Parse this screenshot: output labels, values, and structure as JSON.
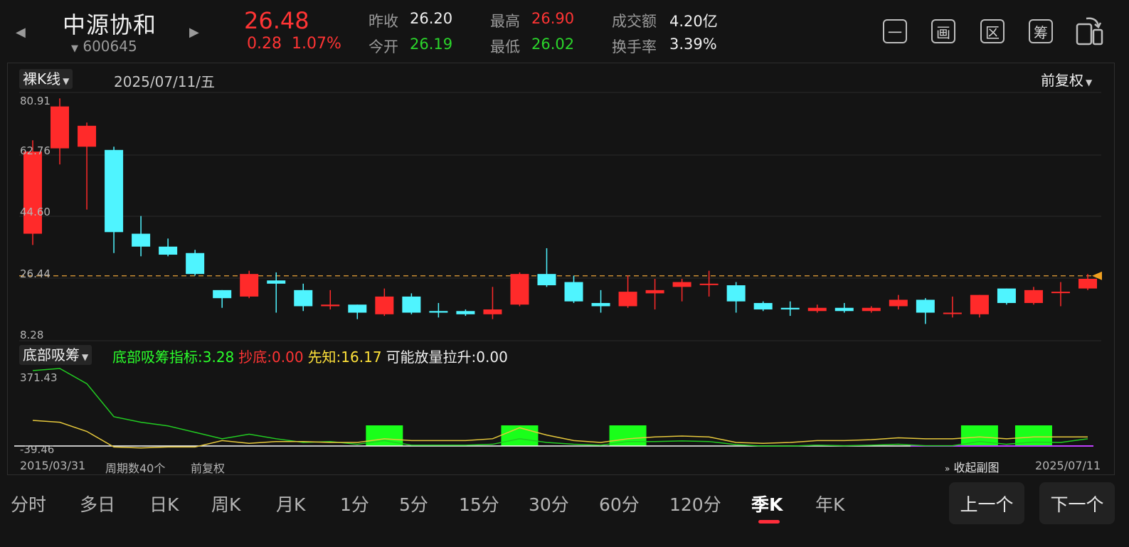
{
  "header": {
    "stock_name": "中源协和",
    "stock_code": "600645",
    "price": "26.48",
    "change_abs": "0.28",
    "change_pct": "1.07%",
    "prev_close_label": "昨收",
    "prev_close": "26.20",
    "open_label": "今开",
    "open": "26.19",
    "high_label": "最高",
    "high": "26.90",
    "low_label": "最低",
    "low": "26.02",
    "turnover_label": "成交额",
    "turnover": "4.20亿",
    "turnover_rate_label": "换手率",
    "turnover_rate": "3.39%",
    "icons": [
      "一",
      "画",
      "区",
      "筹",
      "rotate-screen-icon"
    ]
  },
  "main_chart": {
    "type_selector": "裸K线",
    "date": "2025/07/11/五",
    "adjust_mode": "前复权",
    "y_labels": [
      "80.91",
      "62.76",
      "44.60",
      "26.44",
      "8.28"
    ]
  },
  "indicator": {
    "selector": "底部吸筹",
    "values": [
      {
        "text": "底部吸筹指标:3.28",
        "color": "#2bff2b"
      },
      {
        "text": "抄底:0.00",
        "color": "#ff3434"
      },
      {
        "text": "先知:16.17",
        "color": "#ffe23a"
      },
      {
        "text": "可能放量拉升:0.00",
        "color": "#f0f0f0"
      }
    ],
    "y_top": "371.43",
    "y_bottom": "-39.46"
  },
  "footer": {
    "start_date": "2015/03/31",
    "period_count": "周期数40个",
    "adjust": "前复权",
    "collapse": "收起副图",
    "end_date": "2025/07/11"
  },
  "tabs": [
    "分时",
    "多日",
    "日K",
    "周K",
    "月K",
    "1分",
    "5分",
    "15分",
    "30分",
    "60分",
    "120分",
    "季K",
    "年K"
  ],
  "active_tab": "季K",
  "nav": {
    "prev": "上一个",
    "next": "下一个"
  },
  "colors": {
    "up": "#ff2a2a",
    "down": "#4ff4ff",
    "ref_line": "#e8a23a",
    "green_bar": "#1aff1a",
    "green_line": "#22cc22",
    "yellow_line": "#e6c83c"
  },
  "chart_data": {
    "type": "candlestick",
    "ylim": [
      8.28,
      80.91
    ],
    "last_price_line": 26.44,
    "candles": [
      {
        "o": 39.5,
        "c": 65.0,
        "h": 68.5,
        "l": 36.0
      },
      {
        "o": 66.0,
        "c": 79.0,
        "h": 81.5,
        "l": 61.0
      },
      {
        "o": 66.5,
        "c": 73.0,
        "h": 74.0,
        "l": 47.0
      },
      {
        "o": 65.5,
        "c": 40.0,
        "h": 66.5,
        "l": 33.5
      },
      {
        "o": 39.5,
        "c": 35.5,
        "h": 45.0,
        "l": 32.5
      },
      {
        "o": 35.5,
        "c": 33.0,
        "h": 38.0,
        "l": 32.5
      },
      {
        "o": 33.5,
        "c": 27.0,
        "h": 34.5,
        "l": 26.5
      },
      {
        "o": 22.0,
        "c": 19.5,
        "h": 22.0,
        "l": 16.5
      },
      {
        "o": 20.0,
        "c": 27.0,
        "h": 28.0,
        "l": 19.5
      },
      {
        "o": 25.0,
        "c": 24.0,
        "h": 27.5,
        "l": 15.0
      },
      {
        "o": 22.0,
        "c": 17.0,
        "h": 24.0,
        "l": 15.5
      },
      {
        "o": 17.0,
        "c": 17.5,
        "h": 22.0,
        "l": 16.0
      },
      {
        "o": 17.5,
        "c": 15.0,
        "h": 17.5,
        "l": 13.0
      },
      {
        "o": 14.5,
        "c": 20.0,
        "h": 22.5,
        "l": 14.0
      },
      {
        "o": 20.0,
        "c": 15.0,
        "h": 21.0,
        "l": 14.5
      },
      {
        "o": 15.5,
        "c": 15.0,
        "h": 18.0,
        "l": 13.5
      },
      {
        "o": 15.5,
        "c": 14.5,
        "h": 16.0,
        "l": 14.0
      },
      {
        "o": 14.5,
        "c": 16.0,
        "h": 23.0,
        "l": 13.0
      },
      {
        "o": 17.5,
        "c": 27.0,
        "h": 27.5,
        "l": 17.0
      },
      {
        "o": 27.0,
        "c": 23.5,
        "h": 35.0,
        "l": 23.0
      },
      {
        "o": 24.5,
        "c": 18.5,
        "h": 26.5,
        "l": 18.0
      },
      {
        "o": 18.0,
        "c": 17.0,
        "h": 22.0,
        "l": 15.0
      },
      {
        "o": 17.0,
        "c": 21.5,
        "h": 26.5,
        "l": 16.5
      },
      {
        "o": 21.0,
        "c": 22.0,
        "h": 25.5,
        "l": 16.0
      },
      {
        "o": 23.0,
        "c": 24.5,
        "h": 25.5,
        "l": 18.5
      },
      {
        "o": 24.0,
        "c": 24.0,
        "h": 28.0,
        "l": 20.0
      },
      {
        "o": 23.5,
        "c": 18.5,
        "h": 24.5,
        "l": 15.0
      },
      {
        "o": 18.0,
        "c": 16.0,
        "h": 18.5,
        "l": 15.5
      },
      {
        "o": 16.5,
        "c": 16.0,
        "h": 18.5,
        "l": 14.0
      },
      {
        "o": 15.5,
        "c": 16.5,
        "h": 17.5,
        "l": 15.0
      },
      {
        "o": 16.5,
        "c": 15.5,
        "h": 18.0,
        "l": 15.0
      },
      {
        "o": 15.5,
        "c": 16.5,
        "h": 17.0,
        "l": 15.0
      },
      {
        "o": 17.0,
        "c": 19.0,
        "h": 20.5,
        "l": 16.0
      },
      {
        "o": 19.0,
        "c": 15.0,
        "h": 19.5,
        "l": 11.5
      },
      {
        "o": 15.0,
        "c": 15.0,
        "h": 20.0,
        "l": 13.5
      },
      {
        "o": 14.5,
        "c": 20.5,
        "h": 20.5,
        "l": 13.5
      },
      {
        "o": 22.5,
        "c": 18.0,
        "h": 22.5,
        "l": 17.5
      },
      {
        "o": 18.0,
        "c": 22.0,
        "h": 23.0,
        "l": 17.5
      },
      {
        "o": 21.5,
        "c": 21.5,
        "h": 24.5,
        "l": 17.0
      },
      {
        "o": 22.5,
        "c": 25.5,
        "h": 27.0,
        "l": 22.0
      }
    ],
    "indicator_ylim": [
      -39.46,
      371.43
    ],
    "green_line": [
      371.43,
      400,
      300,
      120,
      90,
      70,
      35,
      0,
      25,
      0,
      -20,
      -15,
      -30,
      -10,
      -35,
      -35,
      -35,
      -30,
      0,
      -20,
      -30,
      -35,
      -15,
      -15,
      -12,
      -15,
      -32,
      -40,
      -40,
      -35,
      -38,
      -35,
      -30,
      -38,
      -38,
      -15,
      -30,
      -18,
      -20,
      0
    ],
    "yellow_line": [
      100,
      90,
      40,
      -45,
      -50,
      -45,
      -45,
      -10,
      -25,
      -15,
      -15,
      -20,
      -20,
      0,
      -10,
      -10,
      -10,
      0,
      60,
      20,
      -10,
      -20,
      0,
      10,
      15,
      10,
      -20,
      -25,
      -20,
      -10,
      -10,
      -5,
      5,
      0,
      0,
      10,
      0,
      10,
      10,
      10
    ],
    "green_bars": [
      13,
      18,
      22,
      35,
      37
    ]
  }
}
